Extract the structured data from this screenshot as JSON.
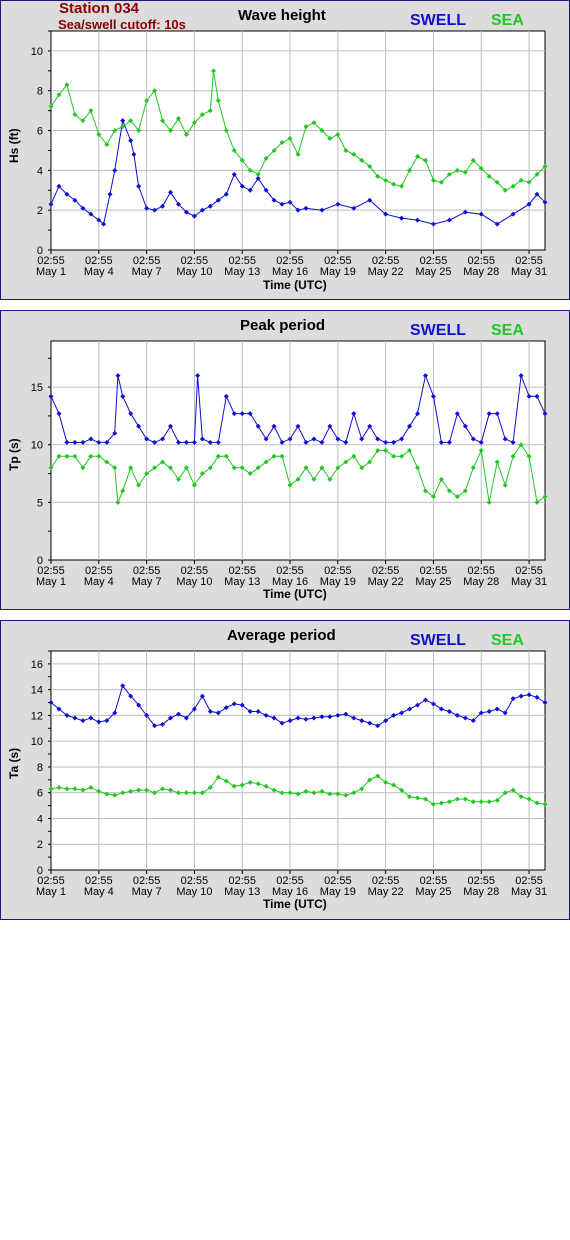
{
  "header": {
    "station": "Station 034",
    "cutoff": "Sea/swell cutoff: 10s"
  },
  "legend": {
    "swell": "SWELL",
    "sea": "SEA"
  },
  "colors": {
    "swell": "#1010d0",
    "sea": "#22c822",
    "grid": "#bdbdbd",
    "title_red": "#8b0000",
    "frame": "#1a1a7a"
  },
  "x_ticks": [
    {
      "time": "02:55",
      "date": "May 1"
    },
    {
      "time": "02:55",
      "date": "May 4"
    },
    {
      "time": "02:55",
      "date": "May 7"
    },
    {
      "time": "02:55",
      "date": "May 10"
    },
    {
      "time": "02:55",
      "date": "May 13"
    },
    {
      "time": "02:55",
      "date": "May 16"
    },
    {
      "time": "02:55",
      "date": "May 19"
    },
    {
      "time": "02:55",
      "date": "May 22"
    },
    {
      "time": "02:55",
      "date": "May 25"
    },
    {
      "time": "02:55",
      "date": "May 28"
    },
    {
      "time": "02:55",
      "date": "May 31"
    }
  ],
  "chart_data": [
    {
      "type": "line",
      "title": "Wave height",
      "ylabel": "Hs (ft)",
      "xlabel": "Time (UTC)",
      "ylim": [
        0,
        11
      ],
      "yticks": [
        0,
        2,
        4,
        6,
        8,
        10
      ],
      "xlim": [
        "May 1 02:55",
        "May 32 03:00"
      ],
      "grid": true,
      "legend_position": "top-right",
      "series": [
        {
          "name": "SWELL",
          "x": [
            1,
            1.5,
            2,
            2.5,
            3,
            3.5,
            4,
            4.3,
            4.7,
            5,
            5.5,
            6,
            6.2,
            6.5,
            7,
            7.5,
            8,
            8.5,
            9,
            9.5,
            10,
            10.5,
            11,
            11.5,
            12,
            12.5,
            13,
            13.5,
            14,
            14.5,
            15,
            15.5,
            16,
            16.5,
            17,
            18,
            19,
            20,
            21,
            22,
            23,
            24,
            25,
            26,
            27,
            28,
            29,
            30,
            31,
            31.5,
            32
          ],
          "y": [
            2.3,
            3.2,
            2.8,
            2.5,
            2.1,
            1.8,
            1.5,
            1.3,
            2.8,
            4.0,
            6.5,
            5.5,
            4.8,
            3.2,
            2.1,
            2.0,
            2.2,
            2.9,
            2.3,
            1.9,
            1.7,
            2.0,
            2.2,
            2.5,
            2.8,
            3.8,
            3.2,
            3.0,
            3.6,
            3.0,
            2.5,
            2.3,
            2.4,
            2.0,
            2.1,
            2.0,
            2.3,
            2.1,
            2.5,
            1.8,
            1.6,
            1.5,
            1.3,
            1.5,
            1.9,
            1.8,
            1.3,
            1.8,
            2.3,
            2.8,
            2.4
          ]
        },
        {
          "name": "SEA",
          "x": [
            1,
            1.5,
            2,
            2.5,
            3,
            3.5,
            4,
            4.5,
            5,
            5.5,
            6,
            6.5,
            7,
            7.5,
            8,
            8.5,
            9,
            9.5,
            10,
            10.5,
            11,
            11.2,
            11.5,
            12,
            12.5,
            13,
            13.5,
            14,
            14.5,
            15,
            15.5,
            16,
            16.5,
            17,
            17.5,
            18,
            18.5,
            19,
            19.5,
            20,
            20.5,
            21,
            21.5,
            22,
            22.5,
            23,
            23.5,
            24,
            24.5,
            25,
            25.5,
            26,
            26.5,
            27,
            27.5,
            28,
            28.5,
            29,
            29.5,
            30,
            30.5,
            31,
            31.5,
            32
          ],
          "y": [
            7.2,
            7.8,
            8.3,
            6.8,
            6.5,
            7.0,
            5.8,
            5.3,
            6.0,
            6.2,
            6.5,
            6.0,
            7.5,
            8.0,
            6.5,
            6.0,
            6.6,
            5.8,
            6.4,
            6.8,
            7.0,
            9.0,
            7.5,
            6.0,
            5.0,
            4.5,
            4.0,
            3.8,
            4.6,
            5.0,
            5.4,
            5.6,
            4.8,
            6.2,
            6.4,
            6.0,
            5.6,
            5.8,
            5.0,
            4.8,
            4.5,
            4.2,
            3.7,
            3.5,
            3.3,
            3.2,
            4.0,
            4.7,
            4.5,
            3.5,
            3.4,
            3.8,
            4.0,
            3.9,
            4.5,
            4.1,
            3.7,
            3.4,
            3.0,
            3.2,
            3.5,
            3.4,
            3.8,
            4.2
          ]
        }
      ]
    },
    {
      "type": "line",
      "title": "Peak period",
      "ylabel": "Tp (s)",
      "xlabel": "Time (UTC)",
      "ylim": [
        0,
        19
      ],
      "yticks": [
        0,
        5,
        10,
        15
      ],
      "xlim": [
        "May 1 02:55",
        "May 32 03:00"
      ],
      "grid": true,
      "legend_position": "top-right",
      "series": [
        {
          "name": "SWELL",
          "x": [
            1,
            1.5,
            2,
            2.5,
            3,
            3.5,
            4,
            4.5,
            5,
            5.2,
            5.5,
            6,
            6.5,
            7,
            7.5,
            8,
            8.5,
            9,
            9.5,
            10,
            10.2,
            10.5,
            11,
            11.5,
            12,
            12.5,
            13,
            13.5,
            14,
            14.5,
            15,
            15.5,
            16,
            16.5,
            17,
            17.5,
            18,
            18.5,
            19,
            19.5,
            20,
            20.5,
            21,
            21.5,
            22,
            22.5,
            23,
            23.5,
            24,
            24.5,
            25,
            25.5,
            26,
            26.5,
            27,
            27.5,
            28,
            28.5,
            29,
            29.5,
            30,
            30.5,
            31,
            31.5,
            32
          ],
          "y": [
            14.2,
            12.7,
            10.2,
            10.2,
            10.2,
            10.5,
            10.2,
            10.2,
            11.0,
            16.0,
            14.2,
            12.7,
            11.6,
            10.5,
            10.2,
            10.5,
            11.6,
            10.2,
            10.2,
            10.2,
            16.0,
            10.5,
            10.2,
            10.2,
            14.2,
            12.7,
            12.7,
            12.7,
            11.6,
            10.5,
            11.6,
            10.2,
            10.5,
            11.6,
            10.2,
            10.5,
            10.2,
            11.6,
            10.5,
            10.2,
            12.7,
            10.5,
            11.6,
            10.5,
            10.2,
            10.2,
            10.5,
            11.6,
            12.7,
            16.0,
            14.2,
            10.2,
            10.2,
            12.7,
            11.6,
            10.5,
            10.2,
            12.7,
            12.7,
            10.5,
            10.2,
            16.0,
            14.2,
            14.2,
            12.7
          ]
        },
        {
          "name": "SEA",
          "x": [
            1,
            1.5,
            2,
            2.5,
            3,
            3.5,
            4,
            4.5,
            5,
            5.2,
            5.5,
            6,
            6.5,
            7,
            7.5,
            8,
            8.5,
            9,
            9.5,
            10,
            10.5,
            11,
            11.5,
            12,
            12.5,
            13,
            13.5,
            14,
            14.5,
            15,
            15.5,
            16,
            16.5,
            17,
            17.5,
            18,
            18.5,
            19,
            19.5,
            20,
            20.5,
            21,
            21.5,
            22,
            22.5,
            23,
            23.5,
            24,
            24.5,
            25,
            25.5,
            26,
            26.5,
            27,
            27.5,
            28,
            28.5,
            29,
            29.5,
            30,
            30.5,
            31,
            31.5,
            32
          ],
          "y": [
            8.0,
            9.0,
            9.0,
            9.0,
            8.0,
            9.0,
            9.0,
            8.5,
            8.0,
            5.0,
            6.0,
            8.0,
            6.5,
            7.5,
            8.0,
            8.5,
            8.0,
            7.0,
            8.0,
            6.5,
            7.5,
            8.0,
            9.0,
            9.0,
            8.0,
            8.0,
            7.5,
            8.0,
            8.5,
            9.0,
            9.0,
            6.5,
            7.0,
            8.0,
            7.0,
            8.0,
            7.0,
            8.0,
            8.5,
            9.0,
            8.0,
            8.5,
            9.5,
            9.5,
            9.0,
            9.0,
            9.5,
            8.0,
            6.0,
            5.5,
            7.0,
            6.0,
            5.5,
            6.0,
            8.0,
            9.5,
            5.0,
            8.5,
            6.5,
            9.0,
            10.0,
            9.0,
            5.0,
            5.5
          ]
        }
      ]
    },
    {
      "type": "line",
      "title": "Average period",
      "ylabel": "Ta (s)",
      "xlabel": "Time (UTC)",
      "ylim": [
        0,
        17
      ],
      "yticks": [
        0,
        2,
        4,
        6,
        8,
        10,
        12,
        14,
        16
      ],
      "xlim": [
        "May 1 02:55",
        "May 32 03:00"
      ],
      "grid": true,
      "legend_position": "top-right",
      "series": [
        {
          "name": "SWELL",
          "x": [
            1,
            1.5,
            2,
            2.5,
            3,
            3.5,
            4,
            4.5,
            5,
            5.5,
            6,
            6.5,
            7,
            7.5,
            8,
            8.5,
            9,
            9.5,
            10,
            10.5,
            11,
            11.5,
            12,
            12.5,
            13,
            13.5,
            14,
            14.5,
            15,
            15.5,
            16,
            16.5,
            17,
            17.5,
            18,
            18.5,
            19,
            19.5,
            20,
            20.5,
            21,
            21.5,
            22,
            22.5,
            23,
            23.5,
            24,
            24.5,
            25,
            25.5,
            26,
            26.5,
            27,
            27.5,
            28,
            28.5,
            29,
            29.5,
            30,
            30.5,
            31,
            31.5,
            32
          ],
          "y": [
            13.0,
            12.5,
            12.0,
            11.8,
            11.6,
            11.8,
            11.5,
            11.6,
            12.2,
            14.3,
            13.5,
            12.8,
            12.0,
            11.2,
            11.3,
            11.8,
            12.1,
            11.8,
            12.5,
            13.5,
            12.3,
            12.2,
            12.6,
            12.9,
            12.8,
            12.3,
            12.3,
            12.0,
            11.8,
            11.4,
            11.6,
            11.8,
            11.7,
            11.8,
            11.9,
            11.9,
            12.0,
            12.1,
            11.8,
            11.6,
            11.4,
            11.2,
            11.6,
            12.0,
            12.2,
            12.5,
            12.8,
            13.2,
            12.9,
            12.5,
            12.3,
            12.0,
            11.8,
            11.6,
            12.2,
            12.3,
            12.5,
            12.2,
            13.3,
            13.5,
            13.6,
            13.4,
            13.0
          ]
        },
        {
          "name": "SEA",
          "x": [
            1,
            1.5,
            2,
            2.5,
            3,
            3.5,
            4,
            4.5,
            5,
            5.5,
            6,
            6.5,
            7,
            7.5,
            8,
            8.5,
            9,
            9.5,
            10,
            10.5,
            11,
            11.5,
            12,
            12.5,
            13,
            13.5,
            14,
            14.5,
            15,
            15.5,
            16,
            16.5,
            17,
            17.5,
            18,
            18.5,
            19,
            19.5,
            20,
            20.5,
            21,
            21.5,
            22,
            22.5,
            23,
            23.5,
            24,
            24.5,
            25,
            25.5,
            26,
            26.5,
            27,
            27.5,
            28,
            28.5,
            29,
            29.5,
            30,
            30.5,
            31,
            31.5,
            32
          ],
          "y": [
            6.3,
            6.4,
            6.3,
            6.3,
            6.2,
            6.4,
            6.1,
            5.9,
            5.8,
            6.0,
            6.1,
            6.2,
            6.2,
            6.0,
            6.3,
            6.2,
            6.0,
            6.0,
            6.0,
            6.0,
            6.4,
            7.2,
            6.9,
            6.5,
            6.6,
            6.8,
            6.7,
            6.5,
            6.2,
            6.0,
            6.0,
            5.9,
            6.1,
            6.0,
            6.1,
            5.9,
            5.9,
            5.8,
            6.0,
            6.3,
            7.0,
            7.3,
            6.8,
            6.6,
            6.2,
            5.7,
            5.6,
            5.5,
            5.1,
            5.2,
            5.3,
            5.5,
            5.5,
            5.3,
            5.3,
            5.3,
            5.4,
            6.0,
            6.2,
            5.7,
            5.5,
            5.2,
            5.1
          ]
        }
      ]
    }
  ]
}
